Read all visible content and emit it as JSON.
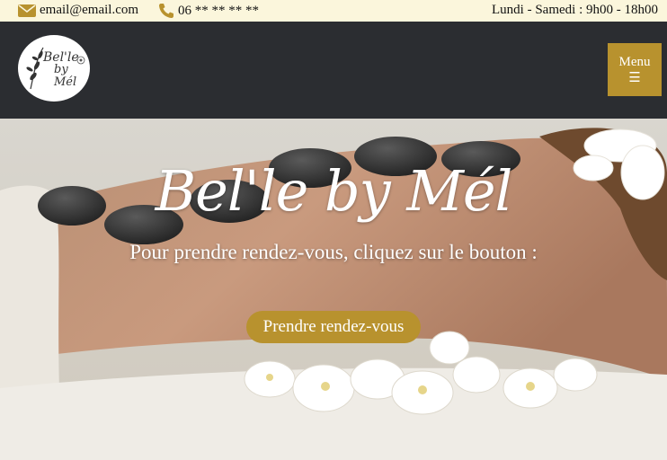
{
  "topbar": {
    "email": "email@email.com",
    "phone": "06 ** ** ** **",
    "hours": "Lundi - Samedi : 9h00 - 18h00"
  },
  "header": {
    "logo_line1": "Bel'le",
    "logo_line2": "by Mél",
    "menu_label": "Menu",
    "menu_icon": "☰"
  },
  "hero": {
    "title": "Bel'le by Mél",
    "subtitle": "Pour prendre rendez-vous, cliquez sur le bouton :",
    "cta_label": "Prendre rendez-vous"
  },
  "colors": {
    "accent": "#b8922e",
    "header_bg": "#2b2d31",
    "topbar_bg": "#fbf6dc"
  }
}
